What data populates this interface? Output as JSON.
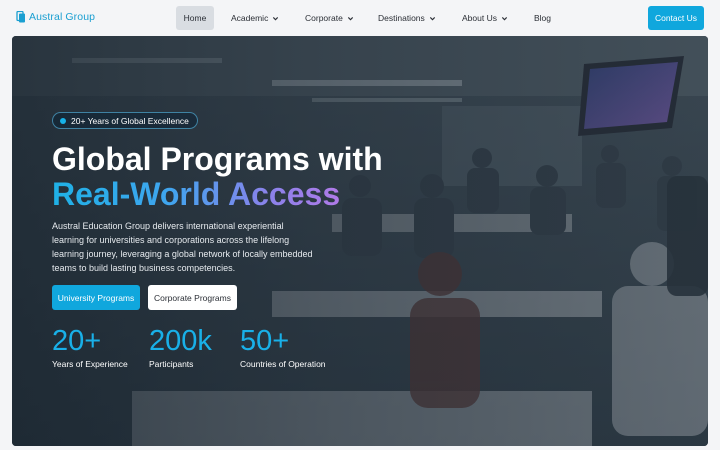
{
  "brand": {
    "name": "Austral Group",
    "accent": "#10a7dd",
    "logo_icon": "stacked-book-icon"
  },
  "nav": {
    "home": "Home",
    "academic": "Academic",
    "corporate": "Corporate",
    "destinations": "Destinations",
    "about": "About Us",
    "blog": "Blog",
    "dropdown_icon": "chevron-down-icon"
  },
  "header": {
    "contact_label": "Contact Us"
  },
  "hero": {
    "badge": "20+ Years of Global Excellence",
    "title_line1": "Global Programs with",
    "title_line2": "Real-World Access",
    "description": "Austral Education Group delivers international experiential learning for universities and corporations across the lifelong learning journey, leveraging a global network of locally embedded teams to build lasting business competencies.",
    "primary_cta": "University Programs",
    "secondary_cta": "Corporate Programs",
    "stats": [
      {
        "value": "20+",
        "label": "Years of Experience"
      },
      {
        "value": "200k",
        "label": "Participants"
      },
      {
        "value": "50+",
        "label": "Countries of Operation"
      }
    ]
  },
  "colors": {
    "primary": "#10a7dd",
    "stat_value": "#19b0e8",
    "nav_active_bg": "#d9dde2",
    "hero_overlay": "#1b2631",
    "gradient_start": "#1fb1e6",
    "gradient_end": "#b07ae8"
  }
}
